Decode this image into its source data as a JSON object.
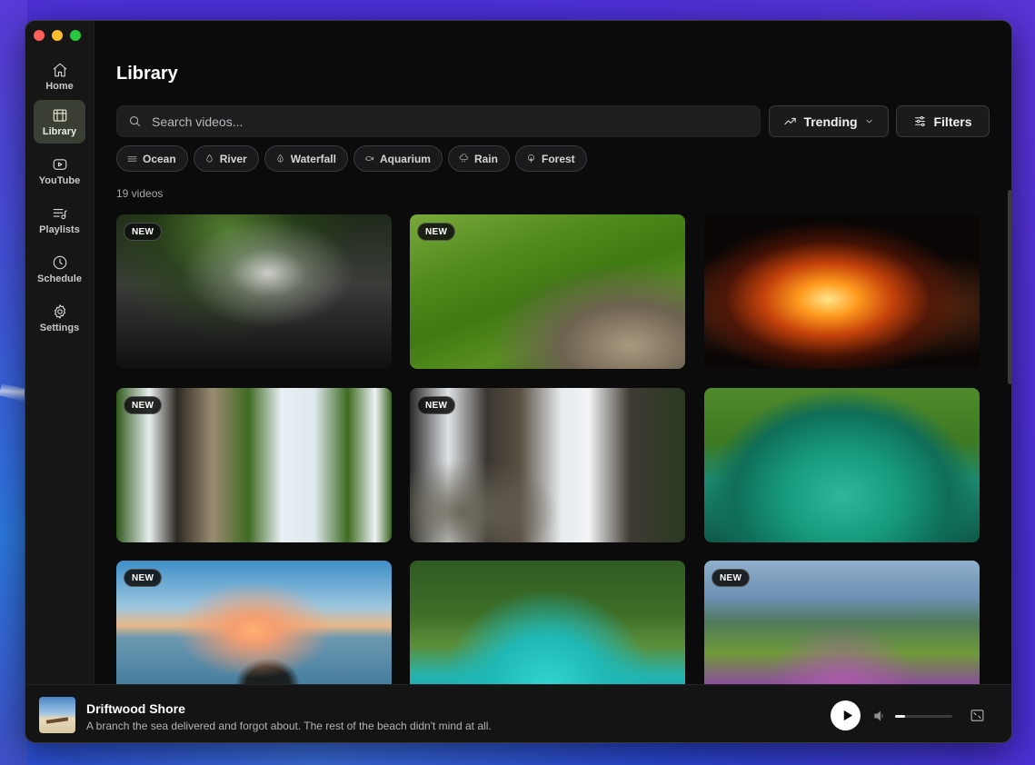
{
  "sidebar": {
    "items": [
      {
        "label": "Home",
        "icon": "home-icon",
        "active": false
      },
      {
        "label": "Library",
        "icon": "library-icon",
        "active": true
      },
      {
        "label": "YouTube",
        "icon": "youtube-icon",
        "active": false
      },
      {
        "label": "Playlists",
        "icon": "playlist-icon",
        "active": false
      },
      {
        "label": "Schedule",
        "icon": "clock-icon",
        "active": false
      },
      {
        "label": "Settings",
        "icon": "gear-icon",
        "active": false
      }
    ]
  },
  "main": {
    "title": "Library",
    "search": {
      "placeholder": "Search videos..."
    },
    "trending_label": "Trending",
    "filters_label": "Filters",
    "chips": [
      {
        "label": "Ocean",
        "icon": "wave-icon"
      },
      {
        "label": "River",
        "icon": "droplet-icon"
      },
      {
        "label": "Waterfall",
        "icon": "waterfall-icon"
      },
      {
        "label": "Aquarium",
        "icon": "fish-icon"
      },
      {
        "label": "Rain",
        "icon": "rain-icon"
      },
      {
        "label": "Forest",
        "icon": "tree-icon"
      }
    ],
    "count_text": "19 videos",
    "videos": [
      {
        "badge": "NEW"
      },
      {
        "badge": "NEW"
      },
      {
        "badge": ""
      },
      {
        "badge": "NEW"
      },
      {
        "badge": "NEW"
      },
      {
        "badge": ""
      },
      {
        "badge": "NEW"
      },
      {
        "badge": ""
      },
      {
        "badge": "NEW"
      }
    ]
  },
  "player": {
    "title": "Driftwood Shore",
    "description": "A branch the sea delivered and forgot about. The rest of the beach didn't mind at all.",
    "volume": 0.18
  },
  "colors": {
    "accent_active_bg": "#3a3f33",
    "window_bg": "#0b0b0c",
    "sidebar_bg": "#161617"
  }
}
